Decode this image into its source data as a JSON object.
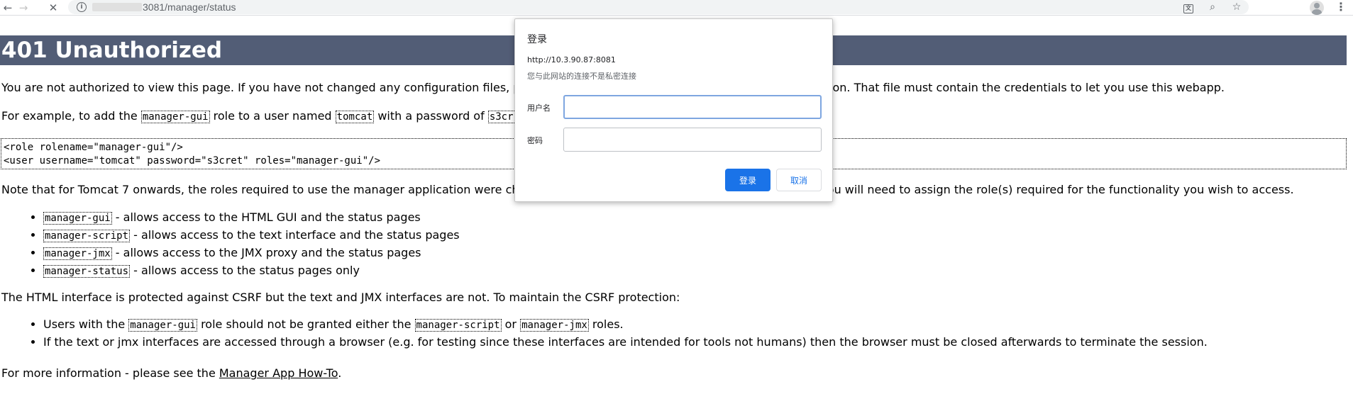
{
  "browser": {
    "back_glyph": "←",
    "forward_glyph": "→",
    "reload_glyph": "✕",
    "info_glyph": "i",
    "url": "3081/manager/status",
    "translate_glyph": "文",
    "zoom_glyph": "⌕",
    "star_glyph": "☆",
    "menu_glyph": "⋮"
  },
  "page": {
    "heading": "401 Unauthorized",
    "p1_a": "You are not authorized to view this page. If you have not changed any configuration files, p",
    "p1_b": "nstallation. That file must contain the credentials to let you use this webapp.",
    "p2_a": "For example, to add the ",
    "p2_code1": "manager-gui",
    "p2_b": " role to a user named ",
    "p2_code2": "tomcat",
    "p2_c": " with a password of ",
    "p2_code3": "s3cr",
    "pre_line1": "<role rolename=\"manager-gui\"/>",
    "pre_line2": "<user username=\"tomcat\" password=\"s3cret\" roles=\"manager-gui\"/>",
    "p3_a": "Note that for Tomcat 7 onwards, the roles required to use the manager application were cha",
    "p3_b": "roles. You will need to assign the role(s) required for the functionality you wish to access.",
    "roles": [
      {
        "code": "manager-gui",
        "text": " - allows access to the HTML GUI and the status pages"
      },
      {
        "code": "manager-script",
        "text": " - allows access to the text interface and the status pages"
      },
      {
        "code": "manager-jmx",
        "text": " - allows access to the JMX proxy and the status pages"
      },
      {
        "code": "manager-status",
        "text": " - allows access to the status pages only"
      }
    ],
    "p4": "The HTML interface is protected against CSRF but the text and JMX interfaces are not. To maintain the CSRF protection:",
    "csrf1_a": "Users with the ",
    "csrf1_code1": "manager-gui",
    "csrf1_b": " role should not be granted either the ",
    "csrf1_code2": "manager-script",
    "csrf1_c": " or ",
    "csrf1_code3": "manager-jmx",
    "csrf1_d": " roles.",
    "csrf2": "If the text or jmx interfaces are accessed through a browser (e.g. for testing since these interfaces are intended for tools not humans) then the browser must be closed afterwards to terminate the session.",
    "p5_a": "For more information - please see the ",
    "p5_link": "Manager App How-To",
    "p5_b": "."
  },
  "dialog": {
    "title": "登录",
    "url": "http://10.3.90.87:8081",
    "note": "您与此网站的连接不是私密连接",
    "username_label": "用户名",
    "username_value": "",
    "password_label": "密码",
    "password_value": "",
    "login_button": "登录",
    "cancel_button": "取消"
  }
}
